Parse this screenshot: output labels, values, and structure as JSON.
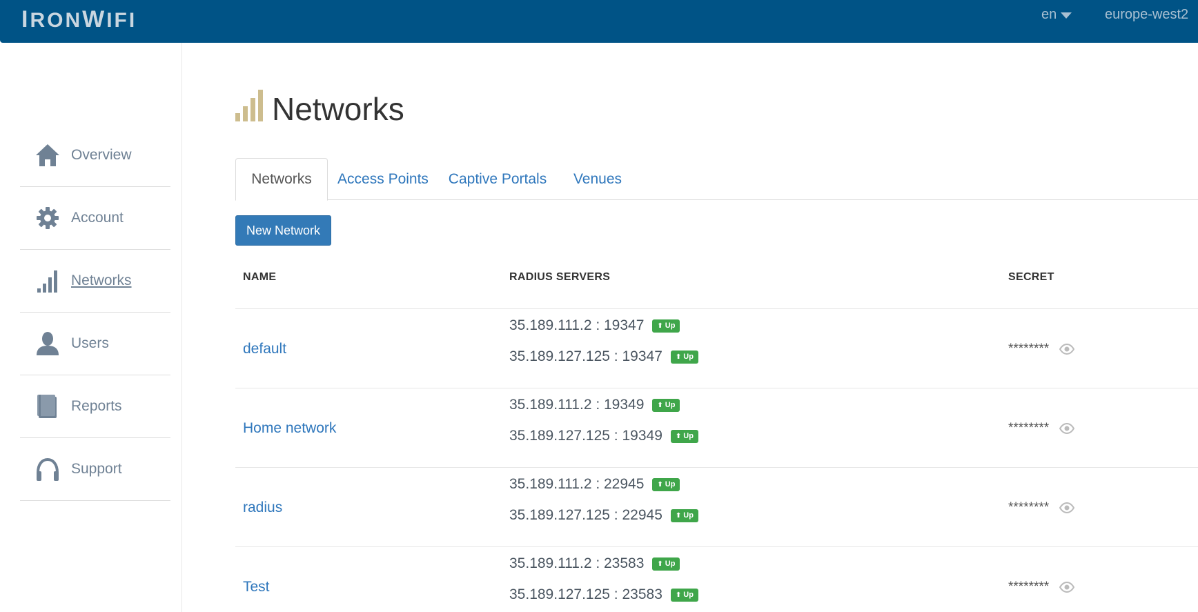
{
  "header": {
    "logo_prefix": "I",
    "logo_rest": "RON",
    "logo_w": "W",
    "logo_rest2": "IFI",
    "language": "en",
    "region": "europe-west2",
    "background": "#005386"
  },
  "sidebar": {
    "items": [
      {
        "label": "Overview",
        "icon": "home-icon",
        "active": false
      },
      {
        "label": "Account",
        "icon": "gear-icon",
        "active": false
      },
      {
        "label": "Networks",
        "icon": "signal-bars-icon",
        "active": true
      },
      {
        "label": "Users",
        "icon": "user-icon",
        "active": false
      },
      {
        "label": "Reports",
        "icon": "book-icon",
        "active": false
      },
      {
        "label": "Support",
        "icon": "headphones-icon",
        "active": false
      }
    ]
  },
  "main": {
    "title": "Networks",
    "title_icon": "signal-bars-icon",
    "tabs": [
      {
        "label": "Networks",
        "active": true
      },
      {
        "label": "Access Points",
        "active": false
      },
      {
        "label": "Captive Portals",
        "active": false
      },
      {
        "label": "Venues",
        "active": false
      }
    ],
    "new_button": "New Network",
    "table": {
      "headers": {
        "name": "NAME",
        "radius": "RADIUS SERVERS",
        "secret": "SECRET"
      },
      "rows": [
        {
          "name": "default",
          "servers": [
            {
              "addr": "35.189.111.2 : 19347",
              "status": "Up"
            },
            {
              "addr": "35.189.127.125 : 19347",
              "status": "Up"
            }
          ],
          "secret": "********"
        },
        {
          "name": "Home network",
          "servers": [
            {
              "addr": "35.189.111.2 : 19349",
              "status": "Up"
            },
            {
              "addr": "35.189.127.125 : 19349",
              "status": "Up"
            }
          ],
          "secret": "********"
        },
        {
          "name": "radius",
          "servers": [
            {
              "addr": "35.189.111.2 : 22945",
              "status": "Up"
            },
            {
              "addr": "35.189.127.125 : 22945",
              "status": "Up"
            }
          ],
          "secret": "********"
        },
        {
          "name": "Test",
          "servers": [
            {
              "addr": "35.189.111.2 : 23583",
              "status": "Up"
            },
            {
              "addr": "35.189.127.125 : 23583",
              "status": "Up"
            }
          ],
          "secret": "********"
        }
      ]
    },
    "colors": {
      "link": "#2f77bc",
      "primary": "#337ab7",
      "status_up": "#3fa64a",
      "title_icon": "#cdbd8e"
    }
  }
}
